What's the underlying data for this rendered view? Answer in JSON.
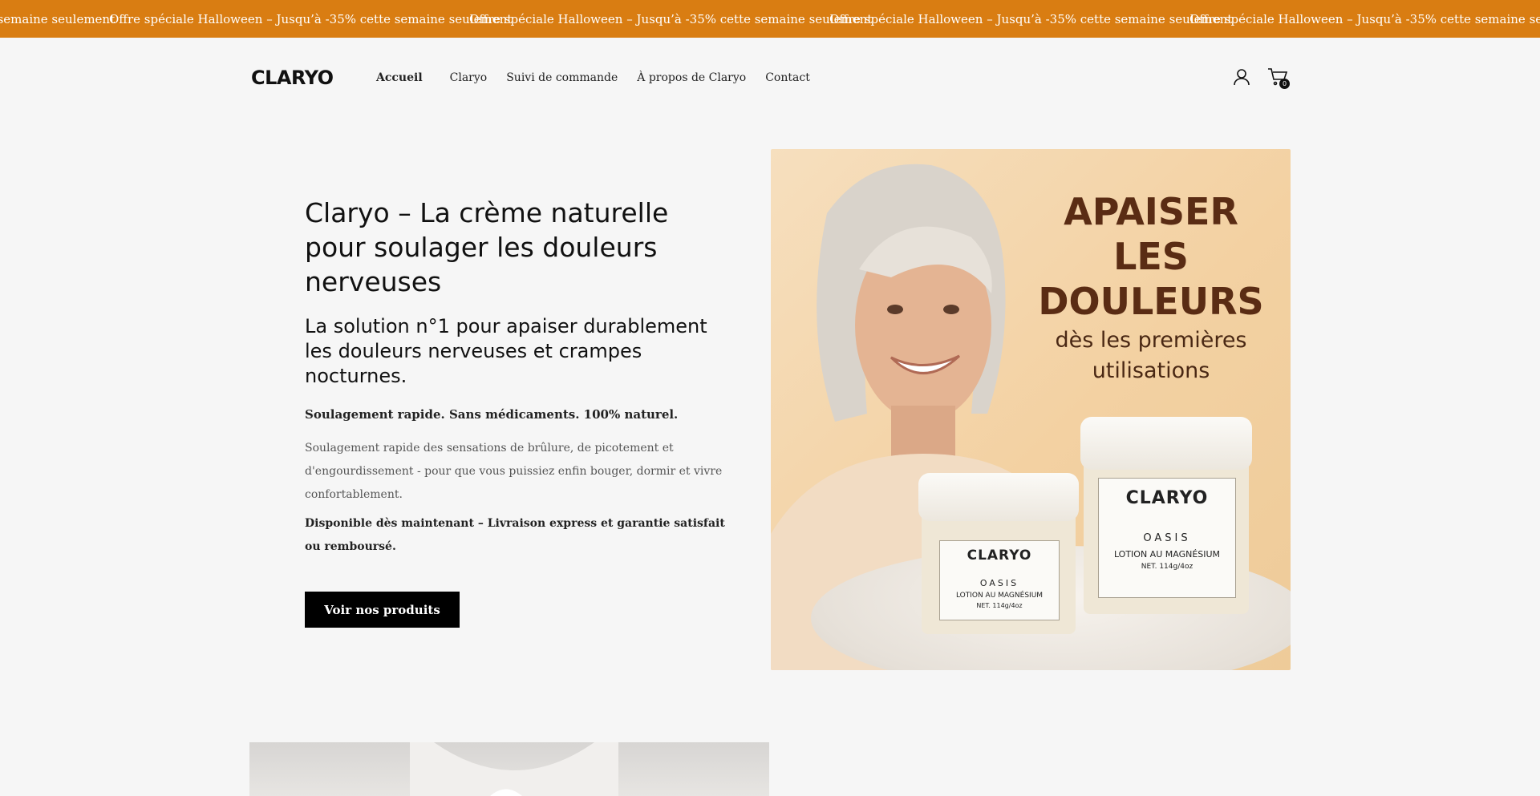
{
  "announcement": {
    "text": "Offre spéciale Halloween – Jusqu’à -35% cette semaine seulement",
    "partial_start": "ette semaine seulement",
    "partial_end": "Offre spéciale Halloween – Jusqu’à -35% cette semaine seulem",
    "background": "#d97d12"
  },
  "header": {
    "logo": "CLARYO",
    "nav": [
      "Accueil",
      "Claryo",
      "Suivi de commande",
      "À propos de Claryo",
      "Contact"
    ],
    "cart_count": "0",
    "icons": {
      "account": "user-icon",
      "cart": "cart-icon"
    }
  },
  "hero": {
    "title": "Claryo – La crème naturelle pour soulager les douleurs nerveuses",
    "subtitle": "La solution n°1 pour apaiser durablement les douleurs nerveuses et crampes nocturnes.",
    "lead": "Soulagement rapide. Sans médicaments. 100% naturel.",
    "description": "Soulagement rapide des sensations de brûlure, de picotement et d'engourdissement - pour que vous puissiez enfin bouger, dormir et vivre confortablement.",
    "note": "Disponible dès maintenant – Livraison express et garantie satisfait ou remboursé.",
    "cta": "Voir nos produits",
    "image": {
      "headline": "APAISER LES DOULEURS",
      "subline": "dès les premières utilisations",
      "jar_brand": "CLARYO",
      "jar_line": "OASIS",
      "jar_product": "LOTION AU MAGNÉSIUM",
      "jar_net": "NET. 114g/4oz"
    }
  }
}
